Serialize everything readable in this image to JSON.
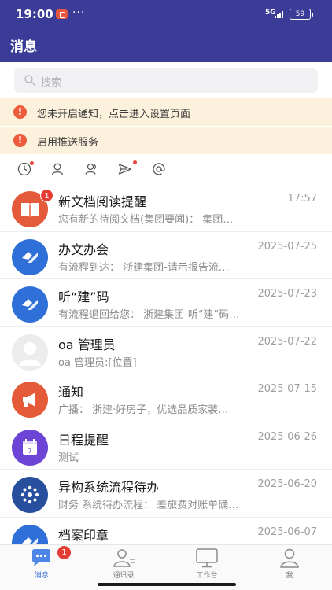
{
  "status_bar": {
    "time": "19:00",
    "dots": "···",
    "network": "5G",
    "battery": "59"
  },
  "header": {
    "title": "消息"
  },
  "search": {
    "placeholder": "搜索"
  },
  "notices": [
    {
      "text": "您未开启通知，点击进入设置页面"
    },
    {
      "text": "启用推送服务"
    }
  ],
  "filters": [
    {
      "icon": "clock-icon",
      "dot": true
    },
    {
      "icon": "person-icon",
      "dot": false
    },
    {
      "icon": "contacts-icon",
      "dot": false
    },
    {
      "icon": "send-icon",
      "dot": true
    },
    {
      "icon": "at-icon",
      "dot": false
    }
  ],
  "messages": [
    {
      "title": "新文档阅读提醒",
      "time": "17:57",
      "subtitle": "您有新的待阅文档(集团要闻)： 集团…",
      "badge": "1",
      "icon": "book-icon",
      "color": "#e45a3b"
    },
    {
      "title": "办文办会",
      "time": "2025-07-25",
      "subtitle": "有流程到达： 浙建集团-请示报告流…",
      "badge": "",
      "icon": "workflow-icon",
      "color": "#2f6fd8"
    },
    {
      "title": "听“建”码",
      "time": "2025-07-23",
      "subtitle": "有流程退回给您： 浙建集团-听“建”码…",
      "badge": "",
      "icon": "workflow-icon",
      "color": "#2f6fd8"
    },
    {
      "title": "oa 管理员",
      "time": "2025-07-22",
      "subtitle": "oa 管理员:[位置]",
      "badge": "",
      "icon": "user-avatar-icon",
      "color": "#e9e9e9"
    },
    {
      "title": "通知",
      "time": "2025-07-15",
      "subtitle": "广播： 浙建·好房子，优选品质家装…",
      "badge": "",
      "icon": "megaphone-icon",
      "color": "#e55a38"
    },
    {
      "title": "日程提醒",
      "time": "2025-06-26",
      "subtitle": "测试",
      "badge": "",
      "icon": "calendar-icon",
      "color": "#6c45d6"
    },
    {
      "title": "异构系统流程待办",
      "time": "2025-06-20",
      "subtitle": "财务 系统待办流程： 差旅费对账单确…",
      "badge": "",
      "icon": "network-icon",
      "color": "#274f9e"
    },
    {
      "title": "档案印章",
      "time": "2025-06-07",
      "subtitle": "",
      "badge": "",
      "icon": "workflow-icon",
      "color": "#2f6fd8"
    }
  ],
  "tabs": [
    {
      "label": "消息",
      "icon": "chat-icon",
      "active": true,
      "badge": "1"
    },
    {
      "label": "通讯录",
      "icon": "contacts-tab-icon",
      "active": false,
      "badge": ""
    },
    {
      "label": "工作台",
      "icon": "monitor-icon",
      "active": false,
      "badge": ""
    },
    {
      "label": "我",
      "icon": "me-icon",
      "active": false,
      "badge": ""
    }
  ]
}
